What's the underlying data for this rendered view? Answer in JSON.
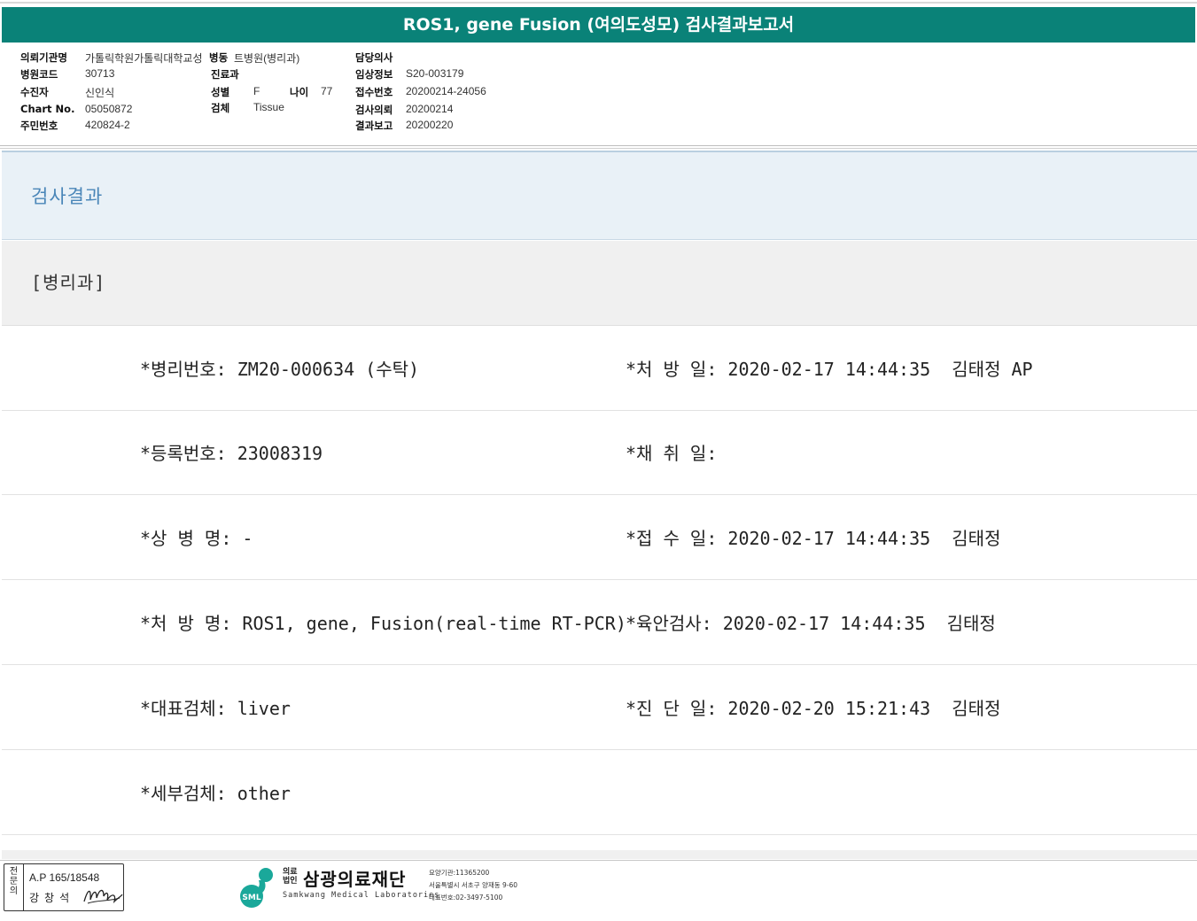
{
  "report": {
    "title": "ROS1, gene Fusion (여의도성모) 검사결과보고서"
  },
  "patient_info": {
    "institution_label": "의뢰기관명",
    "institution_value": "가톨릭학원가톨릭대학교성",
    "ward_label": "병동",
    "ward_value": "트병원(병리과)",
    "attending_label": "담당의사",
    "attending_value": "",
    "hospital_code_label": "병원코드",
    "hospital_code_value": "30713",
    "department_label": "진료과",
    "department_value": "",
    "clinical_info_label": "임상정보",
    "clinical_info_value": "S20-003179",
    "patient_label": "수진자",
    "patient_value": "신인식",
    "sex_label": "성별",
    "sex_value": "F",
    "age_label": "나이",
    "age_value": "77",
    "receipt_no_label": "접수번호",
    "receipt_no_value": "20200214-24056",
    "chart_no_label": "Chart No.",
    "chart_no_value": "05050872",
    "specimen_label": "검체",
    "specimen_value": "Tissue",
    "request_date_label": "검사의뢰",
    "request_date_value": "20200214",
    "resident_no_label": "주민번호",
    "resident_no_value": "420824-2",
    "report_date_label": "결과보고",
    "report_date_value": "20200220"
  },
  "results": {
    "heading": "검사결과",
    "department": "[병리과]",
    "rows": [
      {
        "left": "*병리번호: ZM20-000634 (수탁)",
        "right": "*처 방 일: 2020-02-17 14:44:35  김태정 AP"
      },
      {
        "left": "*등록번호: 23008319",
        "right": "*채 취 일:"
      },
      {
        "left": "*상 병 명: -",
        "right": "*접 수 일: 2020-02-17 14:44:35  김태정"
      },
      {
        "left": "*처 방 명: ROS1, gene, Fusion(real-time RT-PCR)",
        "right": "*육안검사: 2020-02-17 14:44:35  김태정"
      },
      {
        "left": "*대표검체: liver",
        "right": "*진 단 일: 2020-02-20 15:21:43  김태정"
      },
      {
        "left": "*세부검체: other",
        "right": ""
      }
    ]
  },
  "footer": {
    "stamp_vertical": "전문의",
    "stamp_ap": "A.P 165/18548",
    "stamp_doctor": "강창석",
    "logo_corp_line1": "의료",
    "logo_corp_line2": "법인",
    "logo_name": "삼광의료재단",
    "logo_mark_text": "SML",
    "logo_english": "Samkwang Medical Laboratories",
    "logo_code": "요양기관:11365200",
    "logo_address": "서울특별시 서초구 양재동 9-60",
    "logo_phone": "대표번호:02-3497-5100",
    "brand_color": "#0a8278",
    "logo_color": "#1aa89a"
  }
}
